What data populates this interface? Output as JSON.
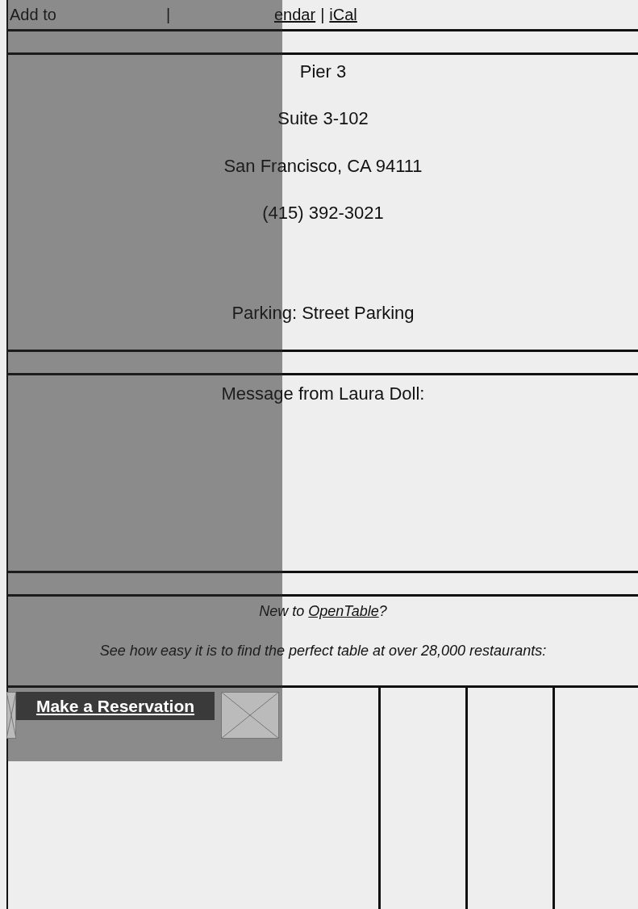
{
  "calendar_bar": [
    {
      "kind": "label",
      "text": "Add to"
    },
    {
      "kind": "separator",
      "text": "|"
    },
    {
      "kind": "link",
      "text": "endar"
    },
    {
      "kind": "separator",
      "text": "|"
    },
    {
      "kind": "link",
      "text": "iCal"
    }
  ],
  "address": {
    "lines": [
      "Pier 3",
      "Suite 3-102",
      "San Francisco, CA 94111",
      "(415) 392-3021"
    ],
    "parking": "Parking: Street Parking"
  },
  "message": {
    "heading": "Message from Laura Doll:"
  },
  "promo": {
    "before": "New to ",
    "link": "OpenTable",
    "after": "?",
    "tagline": "See how easy it is to find the perfect table at over 28,000 restaurants:"
  },
  "overlay": {
    "button": "Make a Reservation"
  }
}
